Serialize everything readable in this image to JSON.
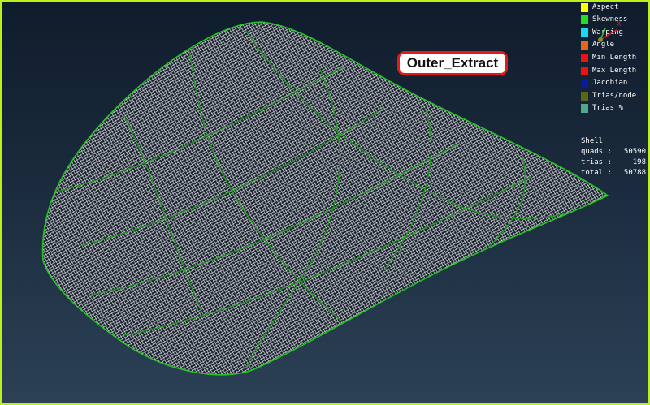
{
  "callout": {
    "label": "Outer_Extract"
  },
  "legend": {
    "items": [
      {
        "label": "Aspect",
        "color": "#ffff00"
      },
      {
        "label": "Skewness",
        "color": "#22dd22"
      },
      {
        "label": "Warping",
        "color": "#19d9ef"
      },
      {
        "label": "Angle",
        "color": "#e8661a"
      },
      {
        "label": "Min Length",
        "color": "#ee1111"
      },
      {
        "label": "Max Length",
        "color": "#ee1111"
      },
      {
        "label": "Jacobian",
        "color": "#0a1aa0"
      },
      {
        "label": "Trias/node",
        "color": "#5c6418"
      },
      {
        "label": "Trias %",
        "color": "#4ea88a"
      }
    ]
  },
  "stats": {
    "title": "Shell",
    "rows": [
      {
        "label": "quads :",
        "value": "50590"
      },
      {
        "label": "trias :",
        "value": "198"
      },
      {
        "label": "total :",
        "value": "50788"
      }
    ]
  },
  "axis": {
    "x_label": "X"
  },
  "colors": {
    "frame": "#b9f01e",
    "mesh_line": "#ffffff",
    "feature_line": "#1f9a1f",
    "callout_border": "#e41a1a"
  }
}
